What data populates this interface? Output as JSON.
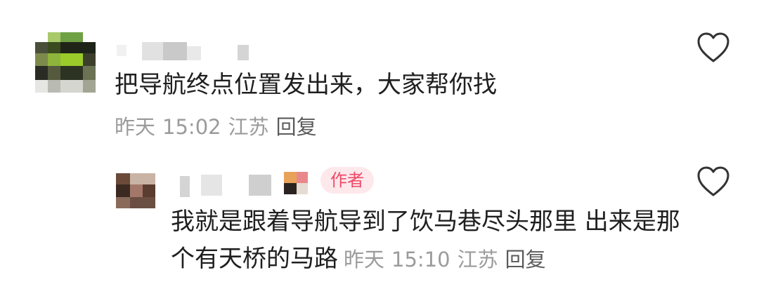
{
  "comment": {
    "text": "把导航终点位置发出来，大家帮你找",
    "date": "昨天",
    "time": "15:02",
    "location": "江苏",
    "reply_label": "回复"
  },
  "reply": {
    "badge": "作者",
    "text": "我就是跟着导航导到了饮马巷尽头那里 出来是那个有天桥的马路",
    "date": "昨天",
    "time": "15:10",
    "location": "江苏",
    "reply_label": "回复"
  },
  "icons": {
    "like": "heart-outline-icon"
  },
  "colors": {
    "text_primary": "#1f1f1f",
    "text_meta": "#9b9b9b",
    "badge_bg": "#fde8ec",
    "badge_text": "#f04a66",
    "icon_stroke": "#333333"
  }
}
